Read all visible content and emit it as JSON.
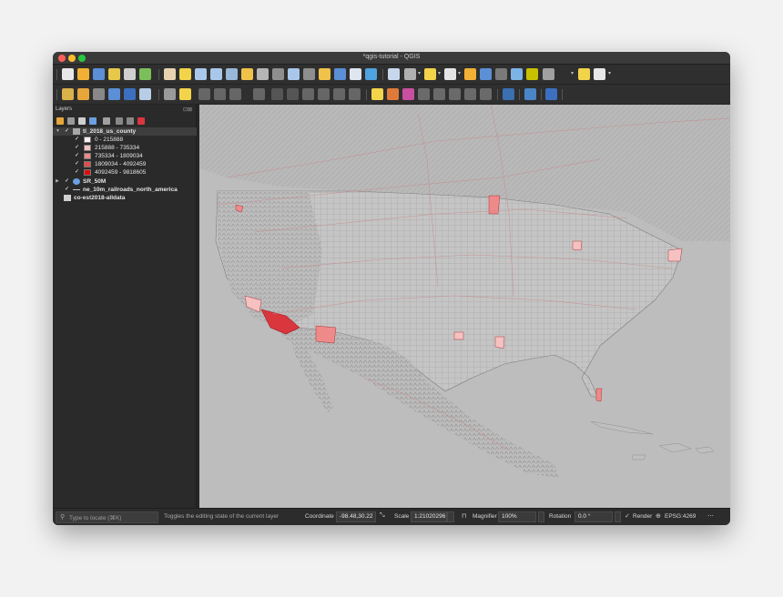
{
  "window": {
    "title": "*qgis-tutorial - QGIS"
  },
  "layers_panel": {
    "title": "Layers",
    "controls": "⊡⊠",
    "layers": [
      {
        "name": "tl_2018_us_county",
        "checked": true,
        "expanded": true
      },
      {
        "name": "SR_50M",
        "checked": true,
        "expanded": false
      },
      {
        "name": "ne_10m_railroads_north_america",
        "checked": true
      },
      {
        "name": "co-est2018-alldata",
        "checked": false
      }
    ],
    "legend": [
      {
        "label": "0 - 215888",
        "color": "#fbeeee"
      },
      {
        "label": "215888 - 735334",
        "color": "#f5c1c1"
      },
      {
        "label": "735334 - 1809034",
        "color": "#ee8a8a"
      },
      {
        "label": "1809034 - 4092459",
        "color": "#e64b4b"
      },
      {
        "label": "4092459 - 9818605",
        "color": "#e00c0c"
      }
    ]
  },
  "status": {
    "locate_placeholder": "Type to locate (⌘K)",
    "message": "Toggles the editing state of the current layer",
    "coordinate_label": "Coordinate",
    "coordinate_value": "-98.48,30.22",
    "scale_label": "Scale",
    "scale_value": "1:21020296",
    "magnifier_label": "Magnifier",
    "magnifier_value": "100%",
    "rotation_label": "Rotation",
    "rotation_value": "0.0 °",
    "render_label": "Render",
    "render_checked": true,
    "crs": "EPSG:4269"
  },
  "colors": {
    "accent_red": "#d9363e",
    "map_background": "#bdbdbd"
  }
}
